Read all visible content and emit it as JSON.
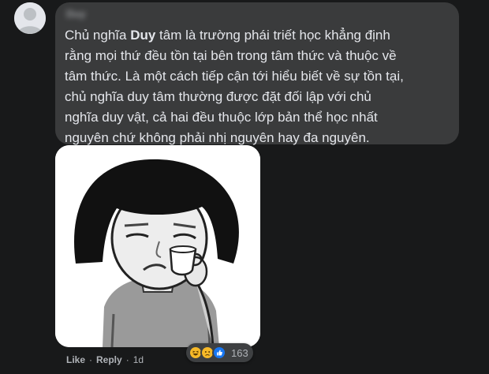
{
  "comment": {
    "author": "Duy",
    "text_lines": [
      {
        "before": "Chủ nghĩa ",
        "bold": "Duy",
        "after": " tâm là trường phái triết học khẳng định"
      },
      {
        "before": "rằng mọi thứ đều tồn tại bên trong tâm thức và thuộc về",
        "bold": "",
        "after": ""
      },
      {
        "before": "tâm thức. Là một cách tiếp cận tới hiểu biết về sự tồn tại,",
        "bold": "",
        "after": ""
      },
      {
        "before": "chủ nghĩa duy tâm thường được đặt đối lập với chủ",
        "bold": "",
        "after": ""
      },
      {
        "before": "nghĩa duy vật, cả hai đều thuộc lớp bản thể học nhất",
        "bold": "",
        "after": ""
      },
      {
        "before": "nguyên chứ không phải nhị nguyên hay đa nguyên.",
        "bold": "",
        "after": ""
      }
    ]
  },
  "reactions": {
    "icons": [
      "haha-icon",
      "sad-icon",
      "like-icon"
    ],
    "count": "163"
  },
  "actions": {
    "like_label": "Like",
    "reply_label": "Reply",
    "separator": "·",
    "time": "1d"
  },
  "colors": {
    "background": "#18191a",
    "bubble": "#3a3b3c",
    "text": "#e4e6eb",
    "secondary": "#b0b3b8",
    "like_blue": "#1877f2",
    "haha_yellow": "#f7b928"
  }
}
